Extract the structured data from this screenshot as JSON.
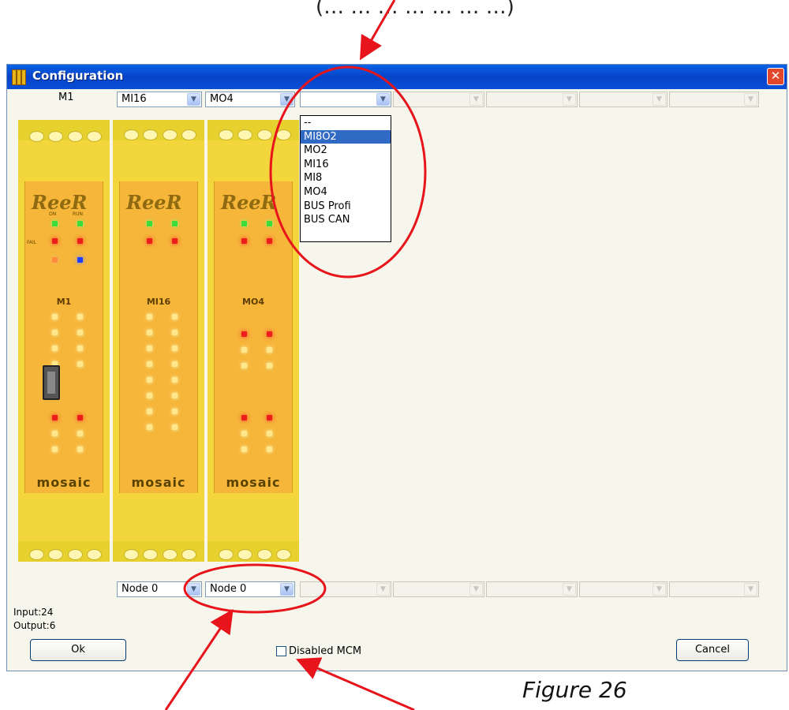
{
  "caption_top": "(… … … … … … …)",
  "figure_caption": "Figure 26",
  "window": {
    "title": "Configuration",
    "close_label": "✕"
  },
  "master_module_label": "M1",
  "module_selectors": [
    {
      "value": "MI16",
      "enabled": true
    },
    {
      "value": "MO4",
      "enabled": true
    },
    {
      "value": "",
      "enabled": true,
      "open": true
    },
    {
      "value": "",
      "enabled": false
    },
    {
      "value": "",
      "enabled": false
    },
    {
      "value": "",
      "enabled": false
    },
    {
      "value": "",
      "enabled": false
    }
  ],
  "dropdown_options": [
    "--",
    "MI8O2",
    "MO2",
    "MI16",
    "MI8",
    "MO4",
    "BUS Profi",
    "BUS CAN"
  ],
  "dropdown_selected": "MI8O2",
  "node_selectors": [
    {
      "value": "Node 0",
      "enabled": true
    },
    {
      "value": "Node 0",
      "enabled": true
    },
    {
      "value": "",
      "enabled": false
    },
    {
      "value": "",
      "enabled": false
    },
    {
      "value": "",
      "enabled": false
    },
    {
      "value": "",
      "enabled": false
    },
    {
      "value": "",
      "enabled": false
    }
  ],
  "modules": [
    {
      "brand": "ReeR",
      "name": "M1",
      "footer": "mosaic"
    },
    {
      "brand": "ReeR",
      "name": "MI16",
      "footer": "mosaic"
    },
    {
      "brand": "ReeR",
      "name": "MO4",
      "footer": "mosaic"
    }
  ],
  "io_summary": {
    "input": "Input:24",
    "output": "Output:6"
  },
  "buttons": {
    "ok": "Ok",
    "cancel": "Cancel"
  },
  "disabled_mcm": {
    "label": "Disabled MCM",
    "checked": false
  },
  "colors": {
    "annotation": "#e8141c",
    "titlebar": "#0a55d8",
    "module_body": "#f2d63b",
    "module_face": "#f5b63a"
  },
  "icons": {
    "arrow": "chevron-down-icon",
    "close": "close-icon",
    "app": "app-icon"
  }
}
